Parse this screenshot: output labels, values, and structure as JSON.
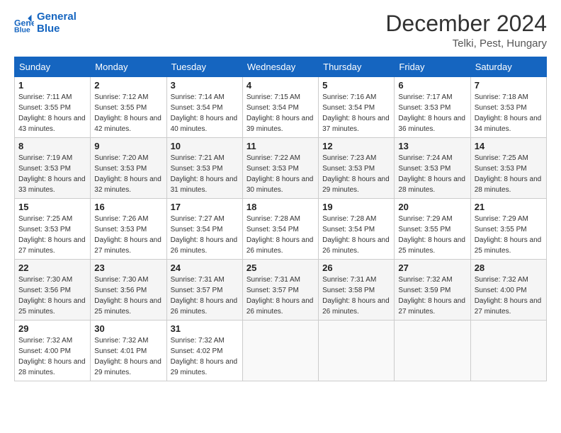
{
  "logo": {
    "line1": "General",
    "line2": "Blue"
  },
  "title": "December 2024",
  "location": "Telki, Pest, Hungary",
  "days_header": [
    "Sunday",
    "Monday",
    "Tuesday",
    "Wednesday",
    "Thursday",
    "Friday",
    "Saturday"
  ],
  "weeks": [
    [
      {
        "day": "1",
        "sunrise": "7:11 AM",
        "sunset": "3:55 PM",
        "daylight": "8 hours and 43 minutes."
      },
      {
        "day": "2",
        "sunrise": "7:12 AM",
        "sunset": "3:55 PM",
        "daylight": "8 hours and 42 minutes."
      },
      {
        "day": "3",
        "sunrise": "7:14 AM",
        "sunset": "3:54 PM",
        "daylight": "8 hours and 40 minutes."
      },
      {
        "day": "4",
        "sunrise": "7:15 AM",
        "sunset": "3:54 PM",
        "daylight": "8 hours and 39 minutes."
      },
      {
        "day": "5",
        "sunrise": "7:16 AM",
        "sunset": "3:54 PM",
        "daylight": "8 hours and 37 minutes."
      },
      {
        "day": "6",
        "sunrise": "7:17 AM",
        "sunset": "3:53 PM",
        "daylight": "8 hours and 36 minutes."
      },
      {
        "day": "7",
        "sunrise": "7:18 AM",
        "sunset": "3:53 PM",
        "daylight": "8 hours and 34 minutes."
      }
    ],
    [
      {
        "day": "8",
        "sunrise": "7:19 AM",
        "sunset": "3:53 PM",
        "daylight": "8 hours and 33 minutes."
      },
      {
        "day": "9",
        "sunrise": "7:20 AM",
        "sunset": "3:53 PM",
        "daylight": "8 hours and 32 minutes."
      },
      {
        "day": "10",
        "sunrise": "7:21 AM",
        "sunset": "3:53 PM",
        "daylight": "8 hours and 31 minutes."
      },
      {
        "day": "11",
        "sunrise": "7:22 AM",
        "sunset": "3:53 PM",
        "daylight": "8 hours and 30 minutes."
      },
      {
        "day": "12",
        "sunrise": "7:23 AM",
        "sunset": "3:53 PM",
        "daylight": "8 hours and 29 minutes."
      },
      {
        "day": "13",
        "sunrise": "7:24 AM",
        "sunset": "3:53 PM",
        "daylight": "8 hours and 28 minutes."
      },
      {
        "day": "14",
        "sunrise": "7:25 AM",
        "sunset": "3:53 PM",
        "daylight": "8 hours and 28 minutes."
      }
    ],
    [
      {
        "day": "15",
        "sunrise": "7:25 AM",
        "sunset": "3:53 PM",
        "daylight": "8 hours and 27 minutes."
      },
      {
        "day": "16",
        "sunrise": "7:26 AM",
        "sunset": "3:53 PM",
        "daylight": "8 hours and 27 minutes."
      },
      {
        "day": "17",
        "sunrise": "7:27 AM",
        "sunset": "3:54 PM",
        "daylight": "8 hours and 26 minutes."
      },
      {
        "day": "18",
        "sunrise": "7:28 AM",
        "sunset": "3:54 PM",
        "daylight": "8 hours and 26 minutes."
      },
      {
        "day": "19",
        "sunrise": "7:28 AM",
        "sunset": "3:54 PM",
        "daylight": "8 hours and 26 minutes."
      },
      {
        "day": "20",
        "sunrise": "7:29 AM",
        "sunset": "3:55 PM",
        "daylight": "8 hours and 25 minutes."
      },
      {
        "day": "21",
        "sunrise": "7:29 AM",
        "sunset": "3:55 PM",
        "daylight": "8 hours and 25 minutes."
      }
    ],
    [
      {
        "day": "22",
        "sunrise": "7:30 AM",
        "sunset": "3:56 PM",
        "daylight": "8 hours and 25 minutes."
      },
      {
        "day": "23",
        "sunrise": "7:30 AM",
        "sunset": "3:56 PM",
        "daylight": "8 hours and 25 minutes."
      },
      {
        "day": "24",
        "sunrise": "7:31 AM",
        "sunset": "3:57 PM",
        "daylight": "8 hours and 26 minutes."
      },
      {
        "day": "25",
        "sunrise": "7:31 AM",
        "sunset": "3:57 PM",
        "daylight": "8 hours and 26 minutes."
      },
      {
        "day": "26",
        "sunrise": "7:31 AM",
        "sunset": "3:58 PM",
        "daylight": "8 hours and 26 minutes."
      },
      {
        "day": "27",
        "sunrise": "7:32 AM",
        "sunset": "3:59 PM",
        "daylight": "8 hours and 27 minutes."
      },
      {
        "day": "28",
        "sunrise": "7:32 AM",
        "sunset": "4:00 PM",
        "daylight": "8 hours and 27 minutes."
      }
    ],
    [
      {
        "day": "29",
        "sunrise": "7:32 AM",
        "sunset": "4:00 PM",
        "daylight": "8 hours and 28 minutes."
      },
      {
        "day": "30",
        "sunrise": "7:32 AM",
        "sunset": "4:01 PM",
        "daylight": "8 hours and 29 minutes."
      },
      {
        "day": "31",
        "sunrise": "7:32 AM",
        "sunset": "4:02 PM",
        "daylight": "8 hours and 29 minutes."
      },
      null,
      null,
      null,
      null
    ]
  ],
  "labels": {
    "sunrise": "Sunrise:",
    "sunset": "Sunset:",
    "daylight": "Daylight:"
  }
}
